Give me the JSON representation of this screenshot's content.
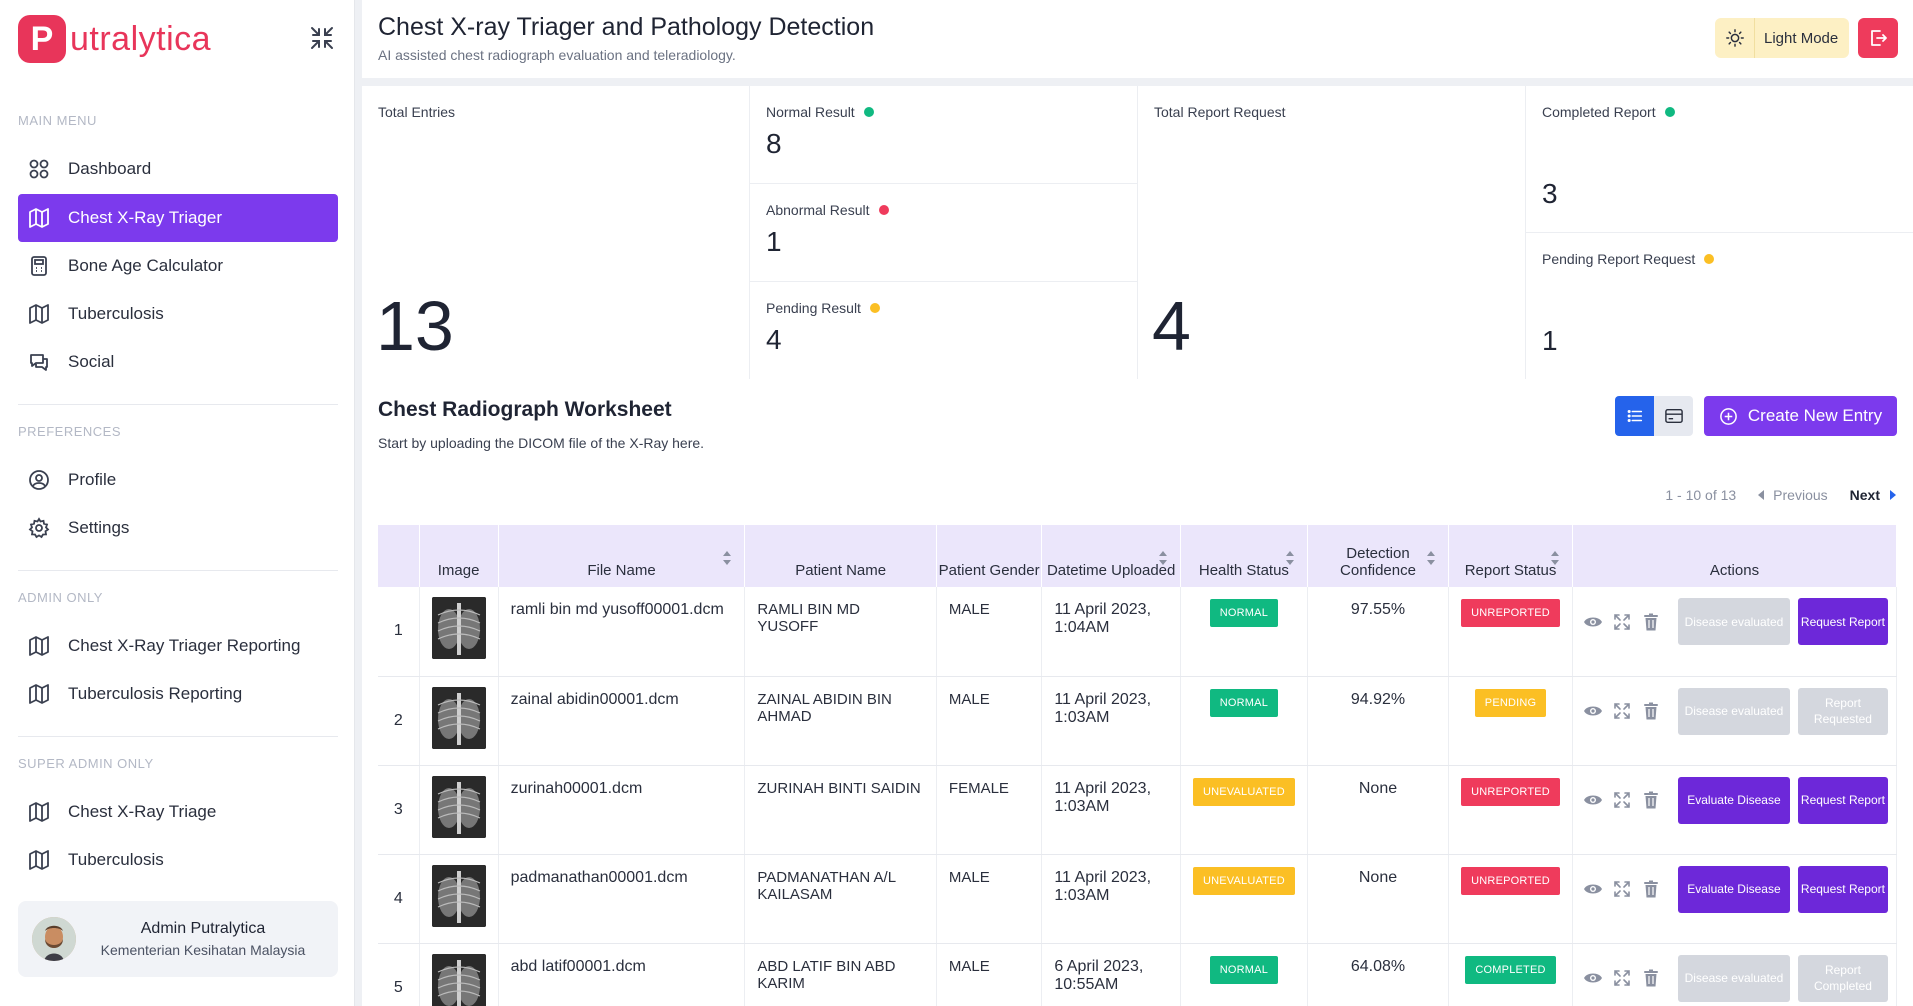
{
  "brand": {
    "letter": "P",
    "name": "utralytica",
    "color": "#e8355a"
  },
  "sidebar": {
    "sections": {
      "main": "MAIN MENU",
      "preferences": "PREFERENCES",
      "admin": "ADMIN ONLY",
      "superadmin": "SUPER ADMIN ONLY"
    },
    "items": {
      "dashboard": "Dashboard",
      "chest": "Chest X-Ray Triager",
      "bone": "Bone Age Calculator",
      "tb": "Tuberculosis",
      "social": "Social",
      "profile": "Profile",
      "settings": "Settings",
      "chest_reporting": "Chest X-Ray Triager Reporting",
      "tb_reporting": "Tuberculosis Reporting",
      "chest_triage": "Chest X-Ray Triage",
      "tb_super": "Tuberculosis"
    },
    "user": {
      "name": "Admin Putralytica",
      "org": "Kementerian Kesihatan Malaysia"
    }
  },
  "header": {
    "title": "Chest X-ray Triager and Pathology Detection",
    "subtitle": "AI assisted chest radiograph evaluation and teleradiology.",
    "theme_label": "Light Mode"
  },
  "stats": {
    "total_entries": {
      "label": "Total Entries",
      "value": "13"
    },
    "normal": {
      "label": "Normal Result",
      "value": "8",
      "color": "#10b981"
    },
    "abnormal": {
      "label": "Abnormal Result",
      "value": "1",
      "color": "#ef3b5c"
    },
    "pending": {
      "label": "Pending Result",
      "value": "4",
      "color": "#fbbf24"
    },
    "total_report": {
      "label": "Total Report Request",
      "value": "4"
    },
    "completed": {
      "label": "Completed Report",
      "value": "3",
      "color": "#10b981"
    },
    "pending_report": {
      "label": "Pending Report Request",
      "value": "1",
      "color": "#fbbf24"
    }
  },
  "worksheet": {
    "title": "Chest Radiograph Worksheet",
    "subtitle": "Start by uploading the DICOM file of the X-Ray here.",
    "create_label": "Create New Entry",
    "pager": {
      "range": "1 - 10 of 13",
      "prev": "Previous",
      "next": "Next"
    },
    "columns": {
      "image": "Image",
      "file": "File Name",
      "patient": "Patient Name",
      "gender": "Patient Gender",
      "date": "Datetime Uploaded",
      "health": "Health Status",
      "conf": "Detection Confidence",
      "report": "Report Status",
      "actions": "Actions"
    },
    "rows": [
      {
        "n": "1",
        "file": "ramli bin md yusoff00001.dcm",
        "patient": "RAMLI BIN MD YUSOFF",
        "gender": "MALE",
        "date": "11 April 2023, 1:04AM",
        "health": "NORMAL",
        "conf": "97.55%",
        "report": "UNREPORTED",
        "btn1": "Disease evaluated",
        "btn2": "Request Report"
      },
      {
        "n": "2",
        "file": "zainal abidin00001.dcm",
        "patient": "ZAINAL ABIDIN BIN AHMAD",
        "gender": "MALE",
        "date": "11 April 2023, 1:03AM",
        "health": "NORMAL",
        "conf": "94.92%",
        "report": "PENDING",
        "btn1": "Disease evaluated",
        "btn2": "Report Requested"
      },
      {
        "n": "3",
        "file": "zurinah00001.dcm",
        "patient": "ZURINAH BINTI SAIDIN",
        "gender": "FEMALE",
        "date": "11 April 2023, 1:03AM",
        "health": "UNEVALUATED",
        "conf": "None",
        "report": "UNREPORTED",
        "btn1": "Evaluate Disease",
        "btn2": "Request Report"
      },
      {
        "n": "4",
        "file": "padmanathan00001.dcm",
        "patient": "PADMANATHAN A/L KAILASAM",
        "gender": "MALE",
        "date": "11 April 2023, 1:03AM",
        "health": "UNEVALUATED",
        "conf": "None",
        "report": "UNREPORTED",
        "btn1": "Evaluate Disease",
        "btn2": "Request Report"
      },
      {
        "n": "5",
        "file": "abd latif00001.dcm",
        "patient": "ABD LATIF BIN ABD KARIM",
        "gender": "MALE",
        "date": "6 April 2023, 10:55AM",
        "health": "NORMAL",
        "conf": "64.08%",
        "report": "COMPLETED",
        "btn1": "Disease evaluated",
        "btn2": "Report Completed"
      }
    ]
  },
  "colors": {
    "accent": "#7c3aed",
    "primary": "#2563eb",
    "danger": "#ef3b5c",
    "success": "#10b981",
    "warning": "#fbbf24"
  }
}
